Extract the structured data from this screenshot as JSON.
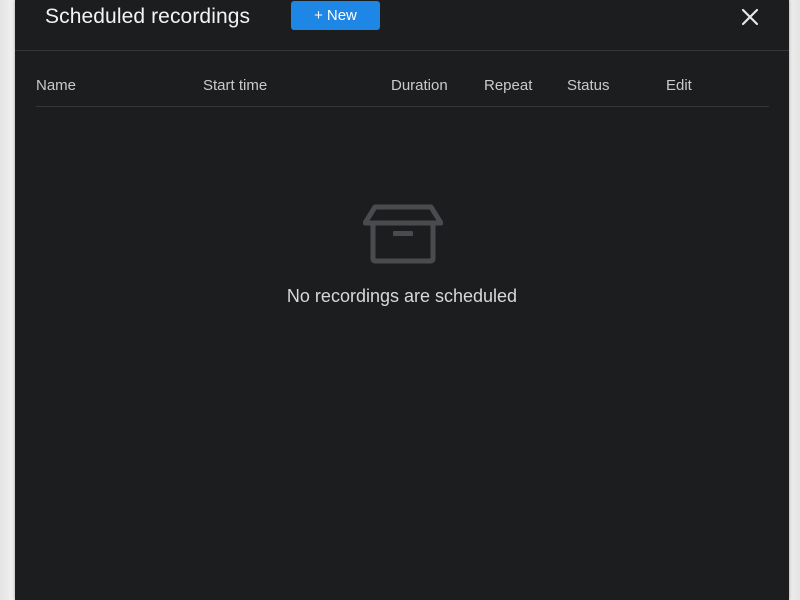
{
  "dialog": {
    "title": "Scheduled recordings",
    "new_button": {
      "plus": "+",
      "label": "New"
    },
    "close_icon": "close-icon"
  },
  "table": {
    "columns": [
      "Name",
      "Start time",
      "Duration",
      "Repeat",
      "Status",
      "Edit"
    ]
  },
  "empty_state": {
    "icon": "archive-box-icon",
    "message": "No recordings are scheduled"
  },
  "colors": {
    "dialog_background": "#1c1d1f",
    "accent": "#1e86e5",
    "text_primary": "#f3f3f3",
    "text_secondary": "#c9cacc",
    "divider": "#343538",
    "icon_muted": "#4a4b4e"
  }
}
